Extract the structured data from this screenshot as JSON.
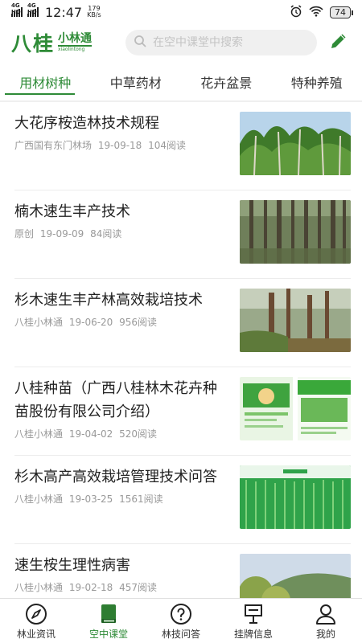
{
  "status_bar": {
    "sim1": "4G HD",
    "sim2": "4G HD",
    "time": "12:47",
    "speed_value": "179",
    "speed_unit": "KB/s",
    "battery": "74"
  },
  "header": {
    "logo_main": "八桂",
    "logo_small": "小林通",
    "logo_en": "xiaolintong",
    "search_placeholder": "在空中课堂中搜索"
  },
  "tabs": [
    {
      "label": "用材树种",
      "active": true
    },
    {
      "label": "中草药材",
      "active": false
    },
    {
      "label": "花卉盆景",
      "active": false
    },
    {
      "label": "特种养殖",
      "active": false
    }
  ],
  "articles": [
    {
      "title": "大花序桉造林技术规程",
      "source": "广西国有东门林场",
      "date": "19-09-18",
      "reads": "104阅读",
      "thumb": "eucalyptus-forest"
    },
    {
      "title": "楠木速生丰产技术",
      "source": "原创",
      "date": "19-09-09",
      "reads": "84阅读",
      "thumb": "nanmu-forest"
    },
    {
      "title": "杉木速生丰产林高效栽培技术",
      "source": "八桂小林通",
      "date": "19-06-20",
      "reads": "956阅读",
      "thumb": "fir-forest"
    },
    {
      "title": "八桂种苗（广西八桂林木花卉种苗股份有限公司介绍）",
      "source": "八桂小林通",
      "date": "19-04-02",
      "reads": "520阅读",
      "thumb": "nursery-brochure",
      "thumb_text": "八桂种苗"
    },
    {
      "title": "杉木高产高效栽培管理技术问答",
      "source": "八桂小林通",
      "date": "19-03-25",
      "reads": "1561阅读",
      "thumb": "fir-cover",
      "thumb_text": "杉木栽培"
    },
    {
      "title": "速生桉生理性病害",
      "source": "八桂小林通",
      "date": "19-02-18",
      "reads": "457阅读",
      "thumb": "eucalyptus-leaves"
    }
  ],
  "bottom_nav": [
    {
      "label": "林业资讯",
      "icon": "compass-icon",
      "active": false
    },
    {
      "label": "空中课堂",
      "icon": "book-icon",
      "active": true
    },
    {
      "label": "林技问答",
      "icon": "question-icon",
      "active": false
    },
    {
      "label": "挂牌信息",
      "icon": "signboard-icon",
      "active": false
    },
    {
      "label": "我的",
      "icon": "user-icon",
      "active": false
    }
  ],
  "colors": {
    "brand_green": "#2e8b37",
    "text_main": "#222222",
    "text_meta": "#999999"
  }
}
